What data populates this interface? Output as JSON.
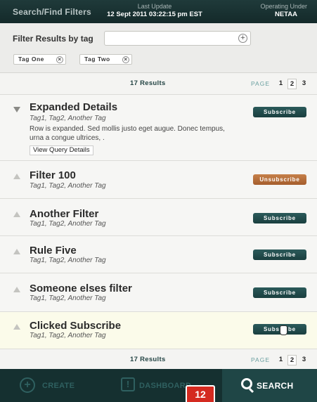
{
  "header": {
    "title": "Search/Find Filters",
    "last_update_label": "Last Update",
    "last_update_value": "12 Sept 2011 03:22:15 pm EST",
    "operating_label": "Operating Under",
    "operating_value": "NETAA"
  },
  "filter": {
    "label": "Filter Results by tag",
    "input_value": "",
    "add_icon": "+",
    "tags": [
      "Tag One",
      "Tag Two"
    ],
    "tag_remove_icon": "×"
  },
  "results": {
    "count_text": "17 Results",
    "page_label": "PAGE",
    "pages": [
      "1",
      "2",
      "3"
    ],
    "active_page": "2"
  },
  "rows": [
    {
      "name": "Expanded Details",
      "tags": "Tag1, Tag2, Another Tag",
      "desc": "Row is expanded. Sed mollis justo eget augue. Donec tempus, urna a congue ultrices, .",
      "link": "View Query Details",
      "button": "Subscribe"
    },
    {
      "name": "Filter 100",
      "tags": "Tag1, Tag2, Another Tag",
      "button": "Unsubscribe"
    },
    {
      "name": "Another Filter",
      "tags": "Tag1, Tag2, Another Tag",
      "button": "Subscribe"
    },
    {
      "name": "Rule Five",
      "tags": "Tag1, Tag2, Another Tag",
      "button": "Subscribe"
    },
    {
      "name": "Someone elses filter",
      "tags": "Tag1, Tag2, Another Tag",
      "button": "Subscribe"
    },
    {
      "name": "Clicked Subscribe",
      "tags": "Tag1, Tag2, Another Tag",
      "button": "Subscribe"
    }
  ],
  "nav": {
    "create": "CREATE",
    "dashboard": "DASHBOARD",
    "search": "SEARCH",
    "badge": "12"
  },
  "colors": {
    "header_bg": "#1f3a3a",
    "subscribe_btn": "#1a3f3f",
    "unsubscribe_btn": "#b06a36",
    "badge": "#d42a20"
  }
}
